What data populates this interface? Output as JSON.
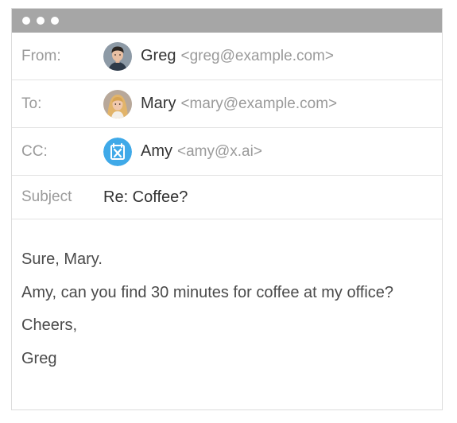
{
  "header": {
    "fields": [
      {
        "label": "From:",
        "name": "Greg",
        "email": "<greg@example.com>",
        "avatar": "greg-avatar"
      },
      {
        "label": "To:",
        "name": "Mary",
        "email": "<mary@example.com>",
        "avatar": "mary-avatar"
      },
      {
        "label": "CC:",
        "name": "Amy",
        "email": "<amy@x.ai>",
        "avatar": "x-ai-logo-icon"
      }
    ],
    "subject": {
      "label": "Subject",
      "value": "Re: Coffee?"
    }
  },
  "body": {
    "lines": [
      "Sure, Mary.",
      "Amy, can you find 30 minutes for coffee at my office?",
      "Cheers,",
      "Greg"
    ]
  },
  "colors": {
    "titlebar": "#a6a6a6",
    "amy_avatar": "#3fa9e8"
  }
}
